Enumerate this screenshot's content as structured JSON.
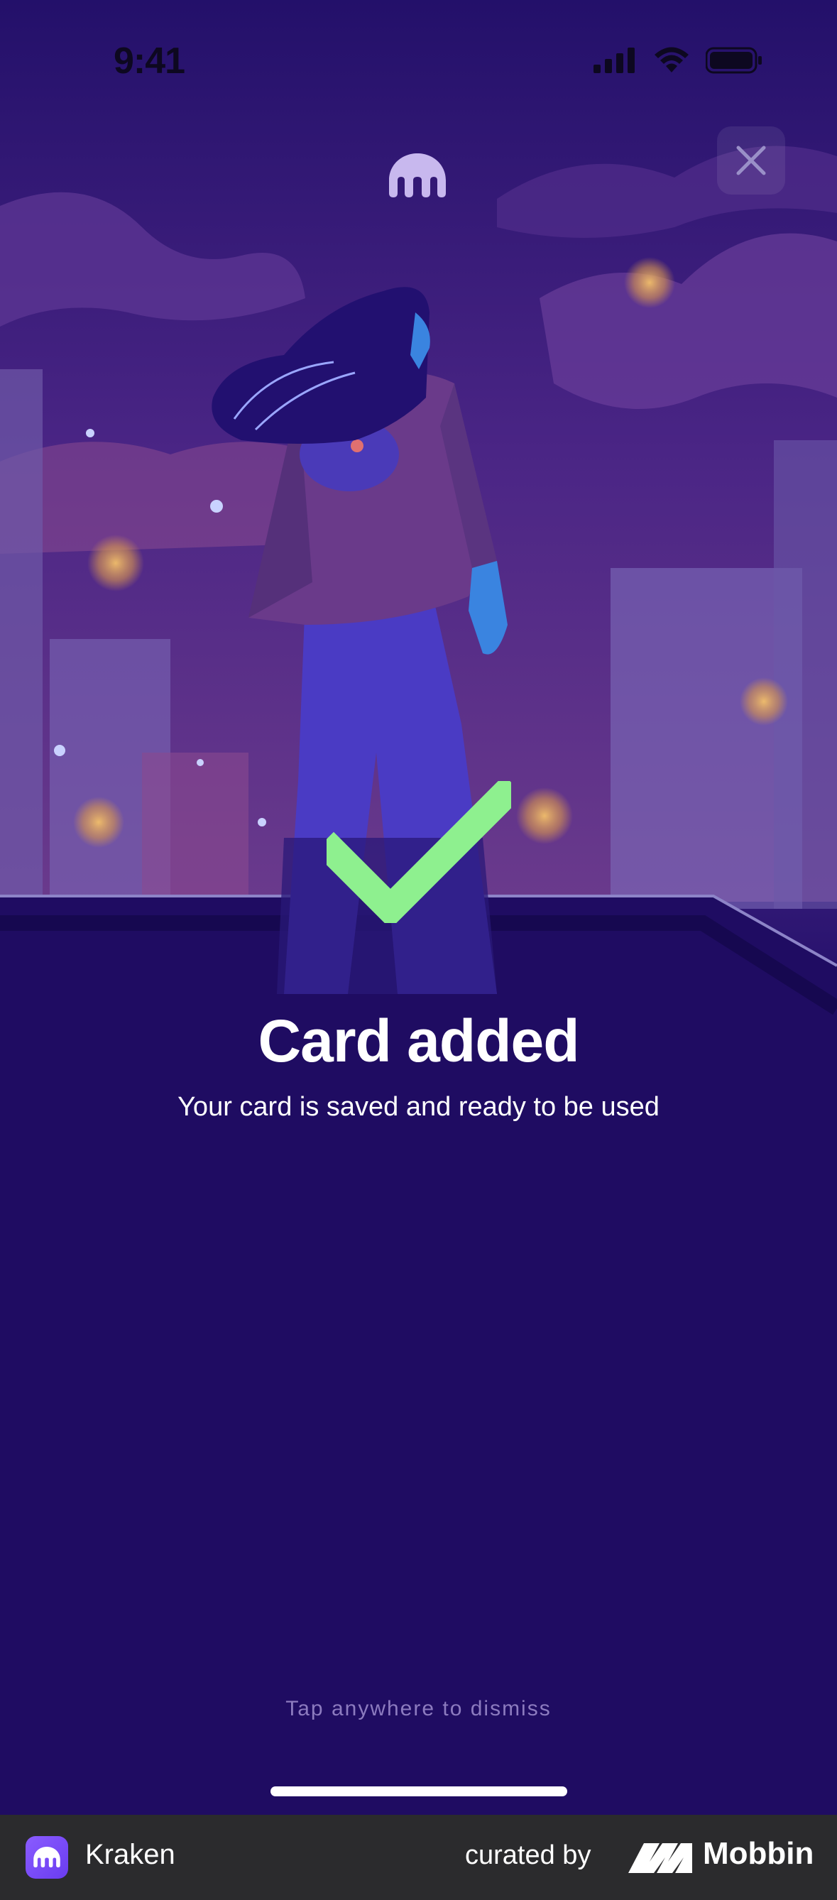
{
  "status_bar": {
    "time": "9:41"
  },
  "header": {
    "logo_icon": "kraken-logo-icon",
    "close_icon": "close-icon"
  },
  "illustration": {
    "subject": "woman-on-rooftop-illustration",
    "check_icon": "checkmark-icon",
    "check_color": "#8ef08f"
  },
  "message": {
    "title": "Card added",
    "subtitle": "Your card is saved and ready to be used",
    "hint": "Tap anywhere to dismiss"
  },
  "footer": {
    "app_name": "Kraken",
    "curated_label": "curated by",
    "brand": "Mobbin"
  },
  "colors": {
    "background": "#1b0a5c",
    "accent": "#8ef08f",
    "footer": "#2b2b2d"
  }
}
